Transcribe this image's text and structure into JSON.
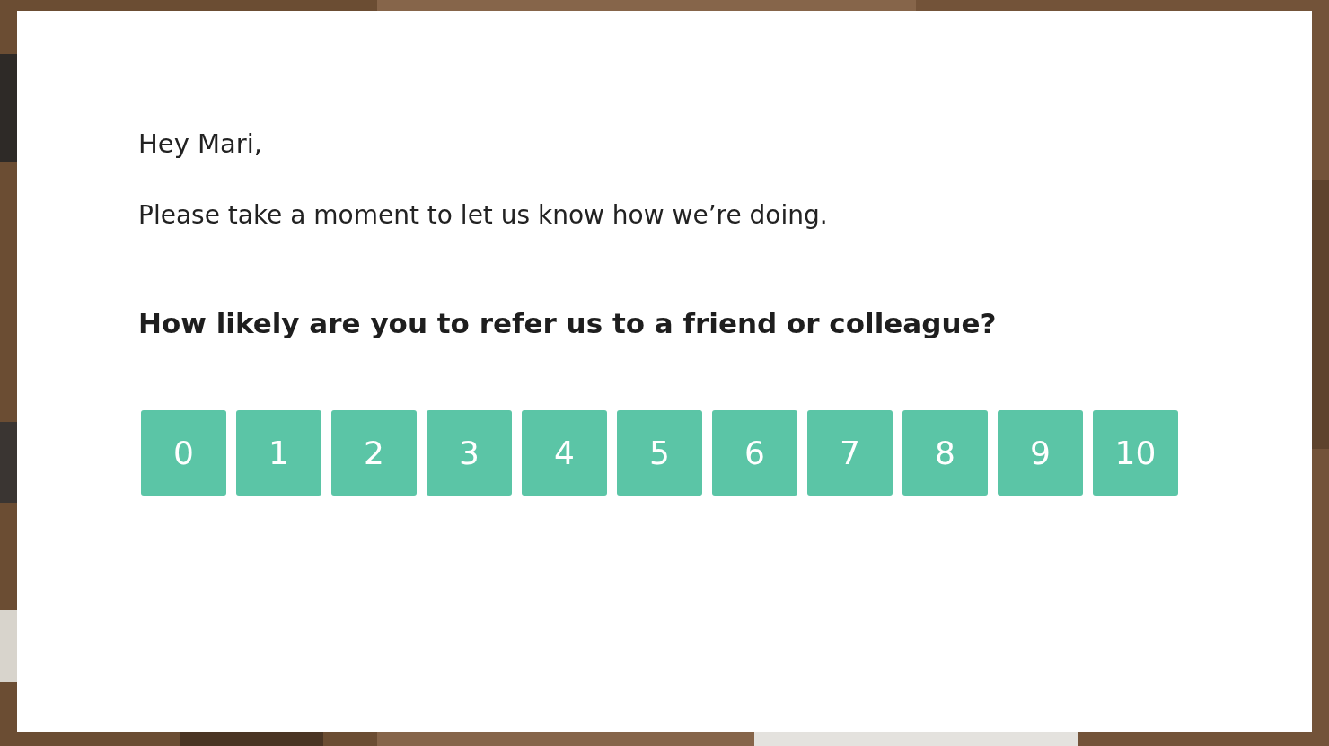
{
  "greeting": "Hey Mari,",
  "message": "Please take a moment to let us know how we’re doing.",
  "question": "How likely are you to refer us to a friend or colleague?",
  "scale": [
    "0",
    "1",
    "2",
    "3",
    "4",
    "5",
    "6",
    "7",
    "8",
    "9",
    "10"
  ]
}
